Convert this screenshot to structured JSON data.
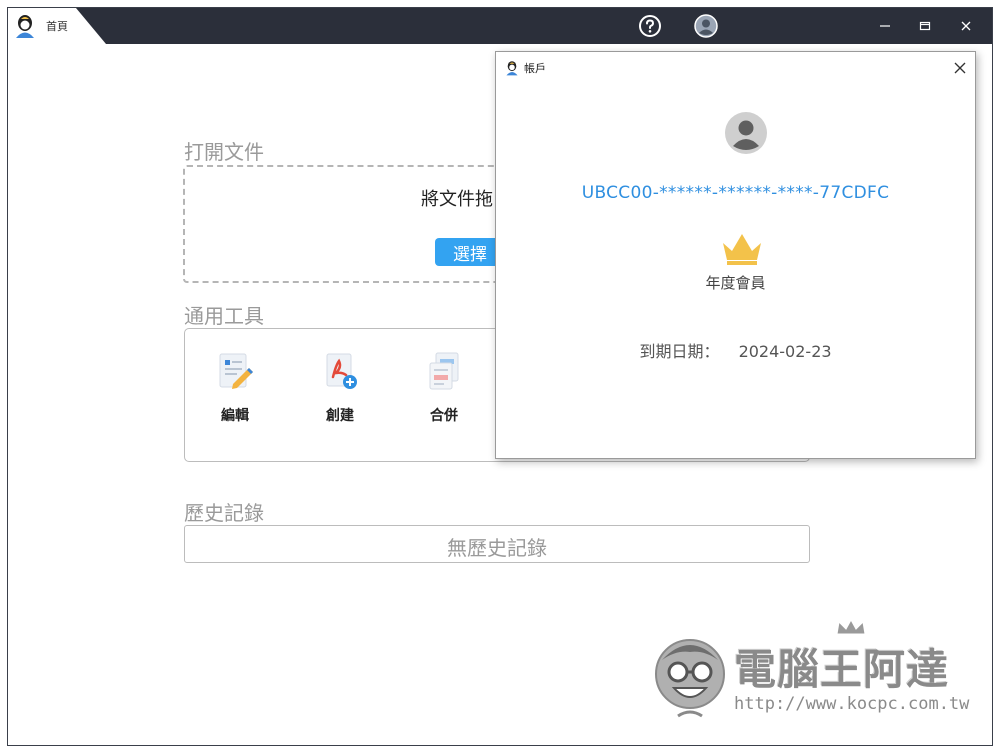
{
  "titlebar": {
    "tab_label": "首頁",
    "icons": [
      "help-icon",
      "account-icon",
      "minimize-icon",
      "maximize-icon",
      "close-icon"
    ]
  },
  "main": {
    "open_doc_title": "打開文件",
    "drop_text": "將文件拖",
    "select_button_label": "選擇",
    "tools_title": "通用工具",
    "tools": [
      {
        "label": "編輯",
        "icon": "edit-document-icon"
      },
      {
        "label": "創建",
        "icon": "create-pdf-icon"
      },
      {
        "label": "合併",
        "icon": "merge-documents-icon"
      }
    ],
    "history_title": "歷史記錄",
    "history_empty": "無歷史記錄"
  },
  "account_dialog": {
    "title": "帳戶",
    "account_id": "UBCC00-******-******-****-77CDFC",
    "membership": "年度會員",
    "expiry_label": "到期日期：",
    "expiry_date": "2024-02-23"
  },
  "watermark": {
    "title": "電腦王阿達",
    "url": "http://www.kocpc.com.tw"
  },
  "colors": {
    "titlebar": "#2b2f3a",
    "accent": "#33a3f1",
    "account_id": "#2f8fe0",
    "crown": "#f3c24a"
  }
}
